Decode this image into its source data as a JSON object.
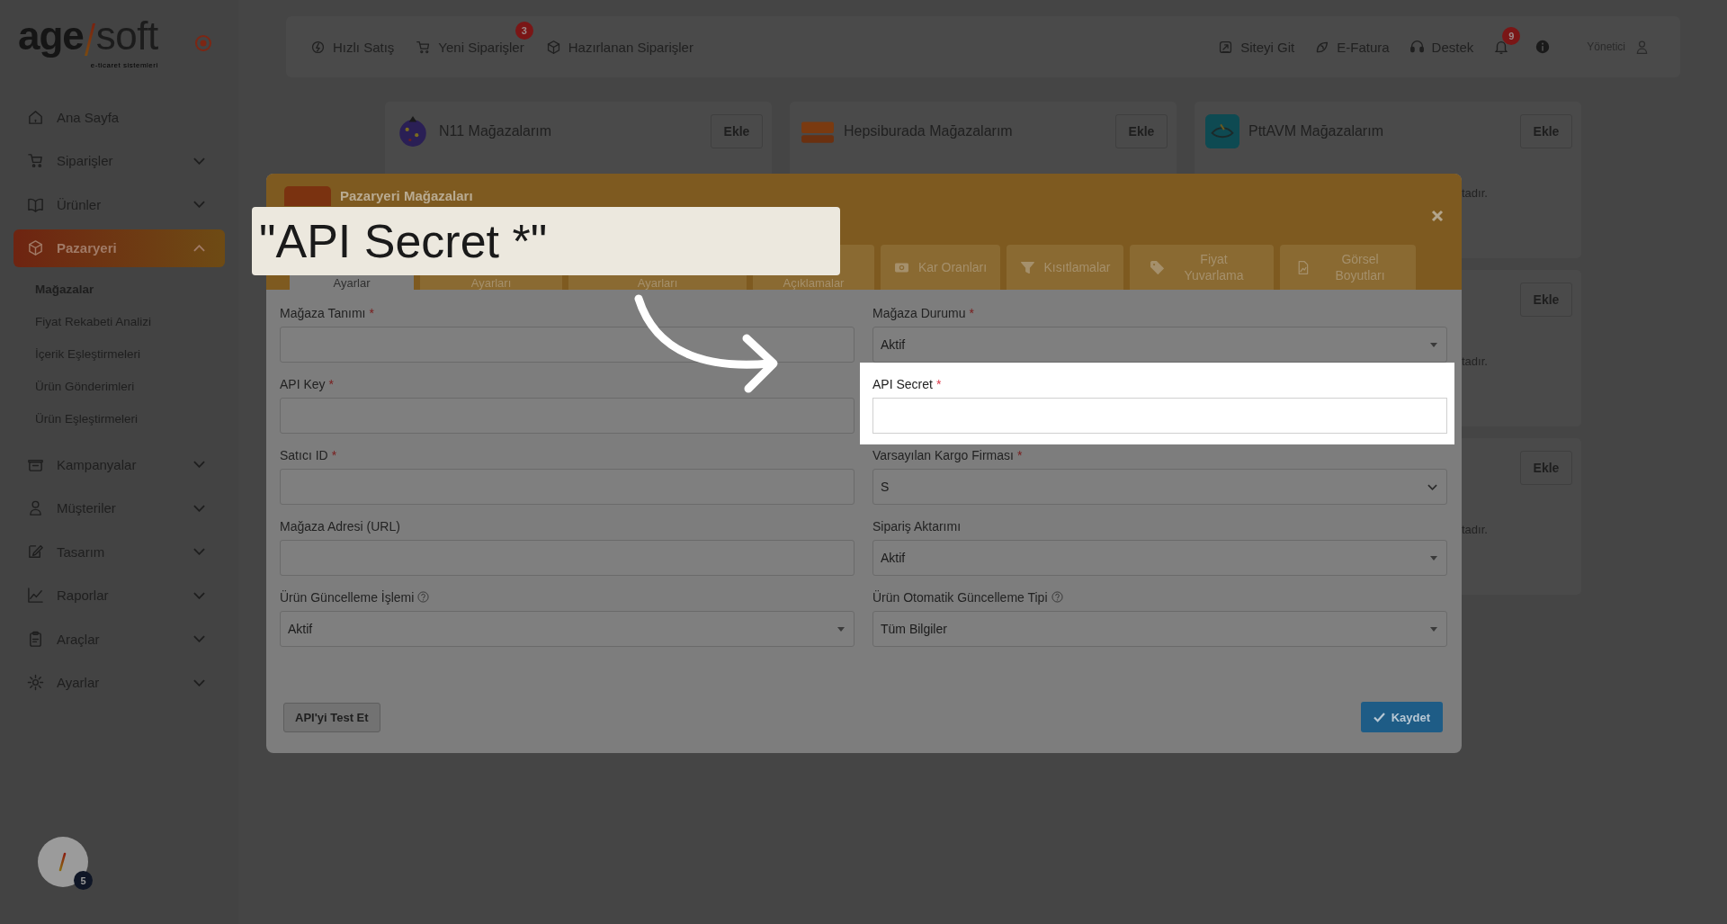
{
  "sidebar": {
    "logo": {
      "left": "age",
      "right": "soft",
      "tagline": "e-ticaret sistemleri"
    },
    "items": [
      {
        "label": "Ana Sayfa",
        "kind": "link",
        "selected": false
      },
      {
        "label": "Siparişler",
        "kind": "menu",
        "selected": false,
        "expanded": false
      },
      {
        "label": "Ürünler",
        "kind": "menu",
        "selected": false,
        "expanded": false
      },
      {
        "label": "Pazaryeri",
        "kind": "menu",
        "selected": true,
        "expanded": true,
        "children": [
          {
            "label": "Mağazalar",
            "selected": true
          },
          {
            "label": "Fiyat Rekabeti Analizi",
            "selected": false
          },
          {
            "label": "İçerik Eşleştirmeleri",
            "selected": false
          },
          {
            "label": "Ürün Gönderimleri",
            "selected": false
          },
          {
            "label": "Ürün Eşleştirmeleri",
            "selected": false
          }
        ]
      },
      {
        "label": "Kampanyalar",
        "kind": "menu",
        "selected": false,
        "expanded": false
      },
      {
        "label": "Müşteriler",
        "kind": "menu",
        "selected": false,
        "expanded": false
      },
      {
        "label": "Tasarım",
        "kind": "menu",
        "selected": false,
        "expanded": false
      },
      {
        "label": "Raporlar",
        "kind": "menu",
        "selected": false,
        "expanded": false
      },
      {
        "label": "Araçlar",
        "kind": "menu",
        "selected": false,
        "expanded": false
      },
      {
        "label": "Ayarlar",
        "kind": "menu",
        "selected": false,
        "expanded": false
      }
    ]
  },
  "float_button": {
    "badge": "5"
  },
  "top_bar": {
    "left_links": [
      {
        "label": "Hızlı Satış"
      },
      {
        "label": "Yeni Siparişler",
        "badge": "3"
      },
      {
        "label": "Hazırlanan Siparişler"
      }
    ],
    "right_links": [
      {
        "label": "Siteyi Git"
      },
      {
        "label": "E-Fatura"
      },
      {
        "label": "Destek"
      }
    ],
    "notifications": "9",
    "user": "Yönetici"
  },
  "store_columns": [
    {
      "cards": [
        {
          "title": "N11 Mağazalarım",
          "button": "Ekle"
        }
      ]
    },
    {
      "cards": [
        {
          "title": "Hepsiburada Mağazalarım",
          "button": "Ekle"
        }
      ]
    },
    {
      "cards": [
        {
          "title": "PttAVM Mağazalarım",
          "button": "Ekle",
          "note": "tadır."
        },
        {
          "button": "Ekle",
          "note": "tadır."
        },
        {
          "button": "Ekle",
          "note": "tadır."
        }
      ]
    }
  ],
  "modal": {
    "title": "Pazaryeri Mağazaları",
    "tabs": [
      {
        "label": "Ayarlar",
        "selected": true
      },
      {
        "label": "Ayarları",
        "selected": false
      },
      {
        "label": "Ayarları",
        "selected": false
      },
      {
        "label": "Açıklamalar",
        "selected": false
      },
      {
        "label": "Kar Oranları",
        "selected": false
      },
      {
        "label": "Kısıtlamalar",
        "selected": false
      },
      {
        "label": "Fiyat Yuvarlama",
        "selected": false
      },
      {
        "label": "Görsel Boyutları",
        "selected": false
      }
    ],
    "fields": [
      {
        "label": "Mağaza Tanımı",
        "required_mark": "*",
        "kind": "input",
        "help": false,
        "highlighted": false
      },
      {
        "label": "Mağaza Durumu",
        "required_mark": "*",
        "kind": "select",
        "value": "Aktif",
        "help": false,
        "highlighted": false
      },
      {
        "label": "API Key",
        "required_mark": "*",
        "kind": "input",
        "help": false,
        "highlighted": false
      },
      {
        "label": "API Secret",
        "required_mark": "*",
        "kind": "input",
        "help": false,
        "highlighted": true
      },
      {
        "label": "Satıcı ID",
        "required_mark": "*",
        "kind": "input",
        "help": false,
        "highlighted": false
      },
      {
        "label": "Varsayılan Kargo Firması",
        "required_mark": "*",
        "kind": "dropdown",
        "value": "S",
        "help": false,
        "highlighted": false
      },
      {
        "label": "Mağaza Adresi (URL)",
        "kind": "input",
        "help": false,
        "highlighted": false
      },
      {
        "label": "Sipariş Aktarımı",
        "kind": "select",
        "value": "Aktif",
        "help": false,
        "highlighted": false
      },
      {
        "label": "Ürün Güncelleme İşlemi",
        "kind": "select",
        "value": "Aktif",
        "help": true,
        "highlighted": false
      },
      {
        "label": "Ürün Otomatik Güncelleme Tipi",
        "kind": "select",
        "value": "Tüm Bilgiler",
        "help": true,
        "highlighted": false
      }
    ],
    "test_button": "API'yi Test Et",
    "save_button": "Kaydet"
  },
  "callout": {
    "text": "\"API Secret *\""
  }
}
